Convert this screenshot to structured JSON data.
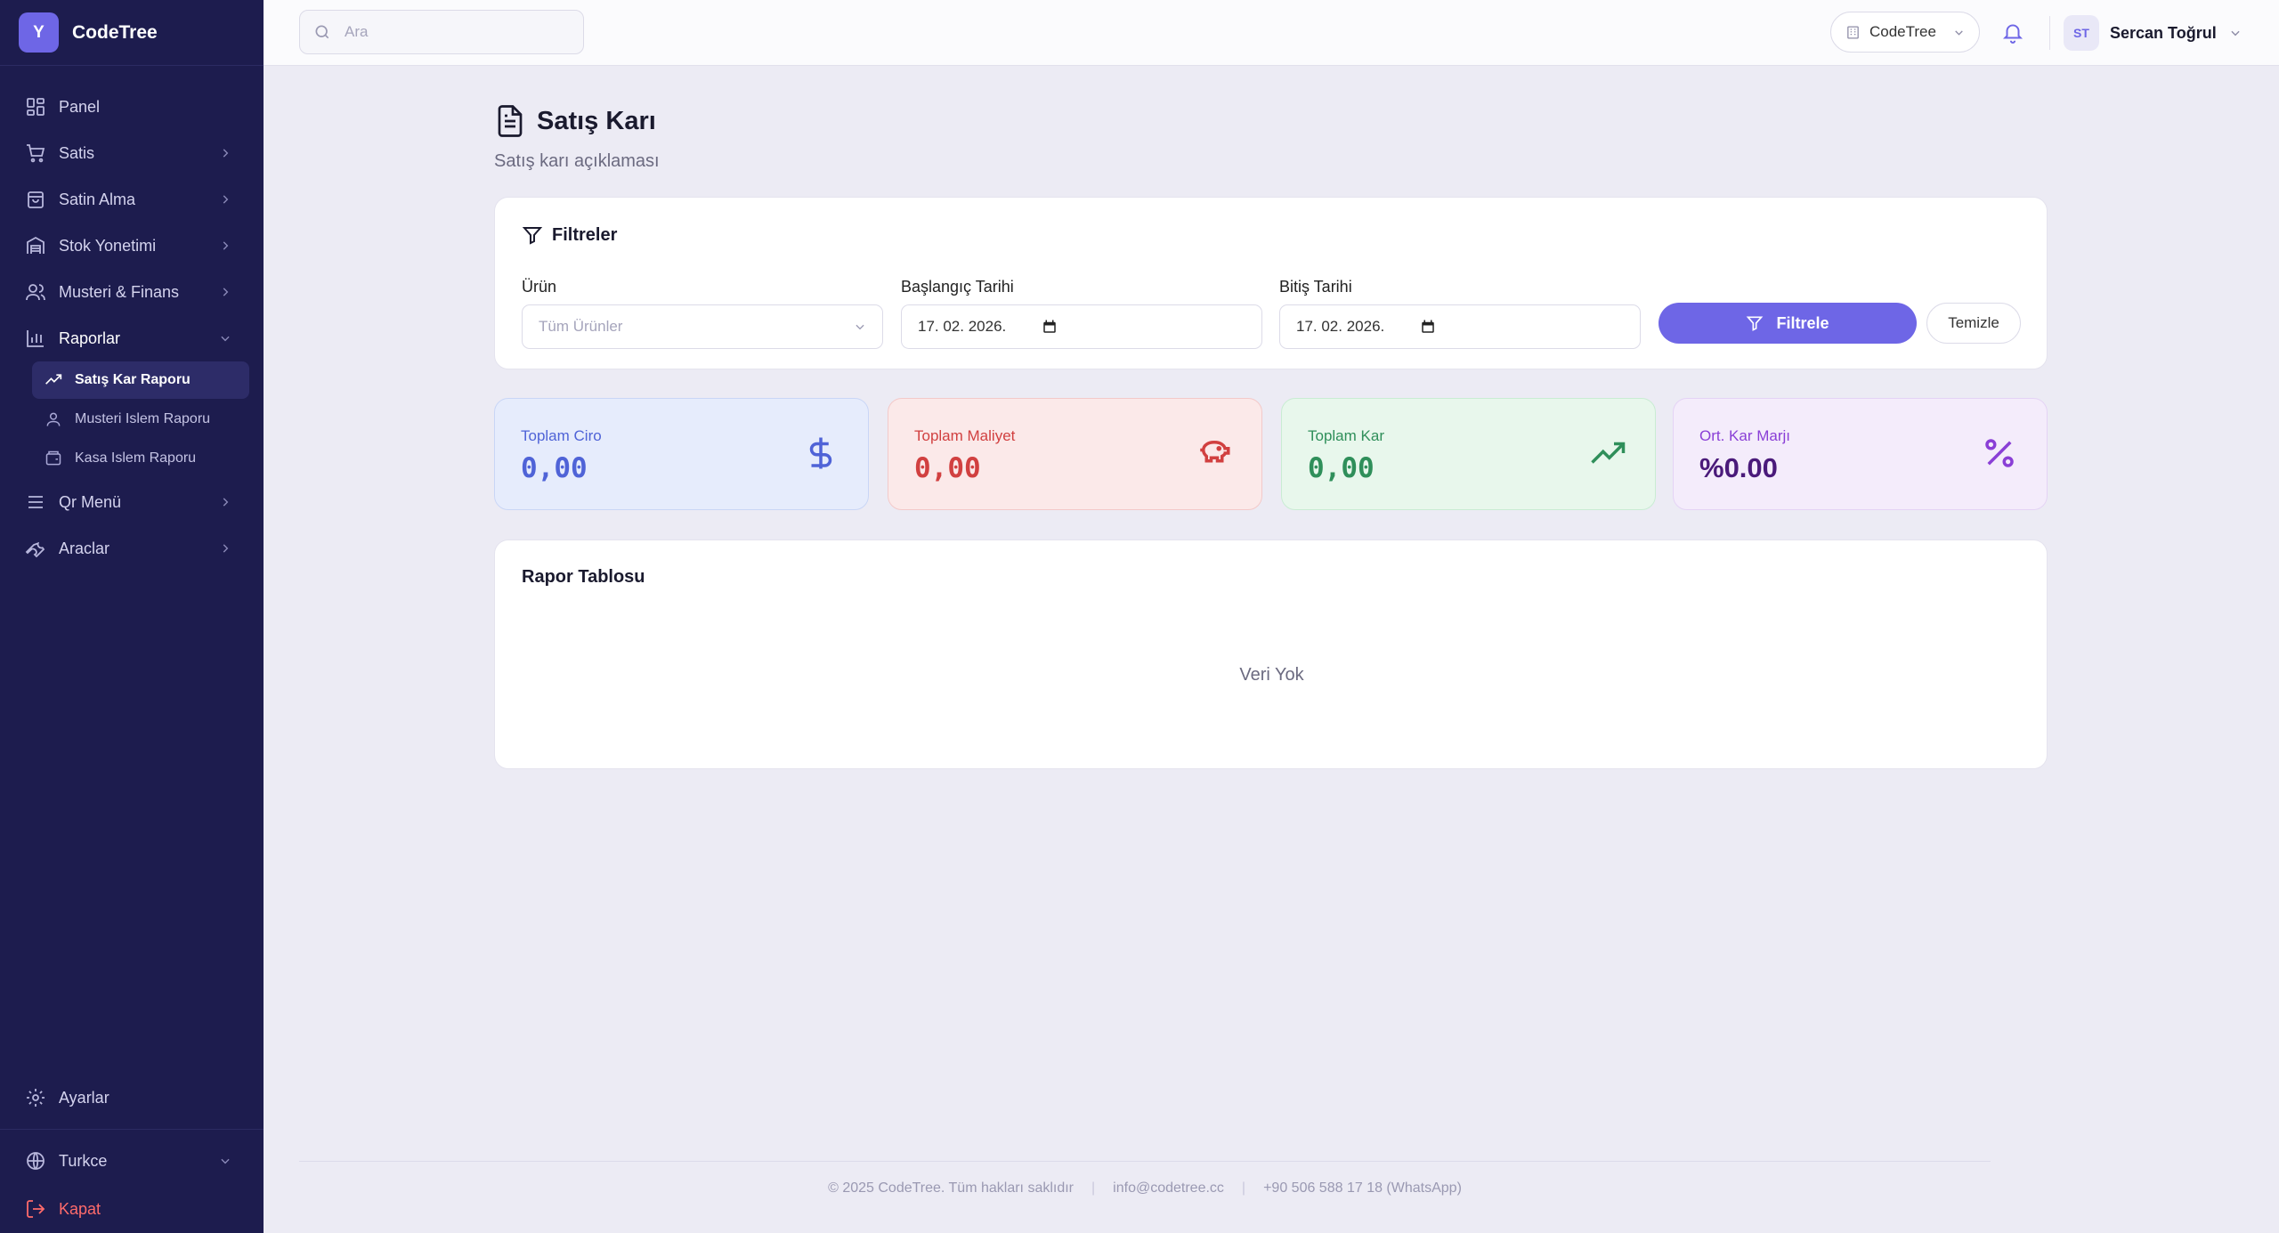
{
  "brand": {
    "logo_letter": "Y",
    "name": "CodeTree"
  },
  "sidebar": {
    "items": [
      {
        "label": "Panel",
        "icon": "dashboard-icon"
      },
      {
        "label": "Satis",
        "icon": "cart-icon"
      },
      {
        "label": "Satin Alma",
        "icon": "shopping-bag-icon"
      },
      {
        "label": "Stok Yonetimi",
        "icon": "warehouse-icon"
      },
      {
        "label": "Musteri & Finans",
        "icon": "users-icon"
      },
      {
        "label": "Raporlar",
        "icon": "bar-chart-icon"
      },
      {
        "label": "Qr Menü",
        "icon": "menu-icon"
      },
      {
        "label": "Araclar",
        "icon": "wrench-icon"
      }
    ],
    "report_sub": [
      {
        "label": "Satış Kar Raporu",
        "icon": "trend-icon"
      },
      {
        "label": "Musteri Islem Raporu",
        "icon": "user-icon"
      },
      {
        "label": "Kasa Islem Raporu",
        "icon": "cashbox-icon"
      }
    ],
    "settings": "Ayarlar",
    "language": "Turkce",
    "logout": "Kapat"
  },
  "topbar": {
    "search_placeholder": "Ara",
    "org": "CodeTree",
    "user_initials": "ST",
    "user_name": "Sercan Toğrul"
  },
  "page": {
    "title": "Satış Karı",
    "subtitle": "Satış karı açıklaması"
  },
  "filters": {
    "title": "Filtreler",
    "product_label": "Ürün",
    "product_placeholder": "Tüm Ürünler",
    "start_label": "Başlangıç Tarihi",
    "start_value": "17. 02. 2026.",
    "end_label": "Bitiş Tarihi",
    "end_value": "17. 02. 2026.",
    "filter_button": "Filtrele",
    "clear_button": "Temizle"
  },
  "stats": [
    {
      "label": "Toplam Ciro",
      "value": "0,00",
      "icon": "dollar-icon",
      "color": "#4f63d7"
    },
    {
      "label": "Toplam Maliyet",
      "value": "0,00",
      "icon": "piggy-bank-icon",
      "color": "#d14040"
    },
    {
      "label": "Toplam Kar",
      "value": "0,00",
      "icon": "trending-up-icon",
      "color": "#2f8f5a"
    },
    {
      "label": "Ort. Kar Marjı",
      "value": "%0.00",
      "icon": "percent-icon",
      "color": "#8a3fd6"
    }
  ],
  "report": {
    "title": "Rapor Tablosu",
    "empty_text": "Veri Yok"
  },
  "footer": {
    "copyright": "© 2025 CodeTree. Tüm hakları saklıdır",
    "email": "info@codetree.cc",
    "phone": "+90 506 588 17 18 (WhatsApp)"
  },
  "colors": {
    "sidebar_bg": "#1d1c4e",
    "accent": "#6e66e6",
    "logout": "#ff6b6b"
  }
}
